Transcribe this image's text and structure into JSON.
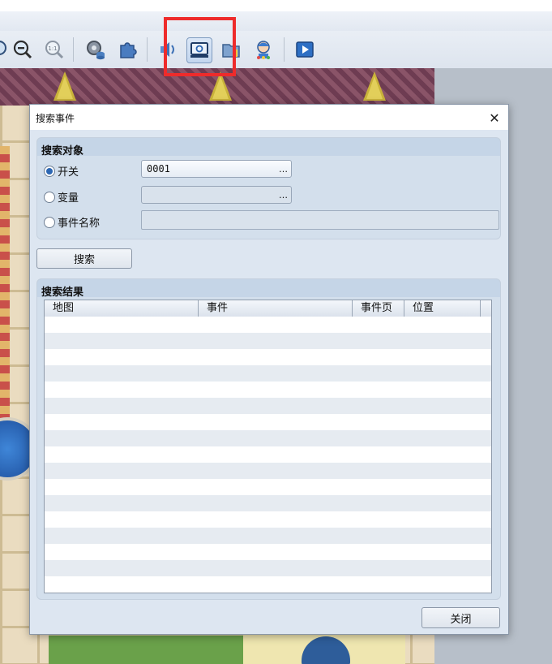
{
  "dialog": {
    "title": "搜索事件",
    "close_symbol": "✕"
  },
  "search_target": {
    "heading": "搜索对象",
    "options": [
      {
        "label": "开关",
        "selected": true,
        "value": "0001",
        "button": "…"
      },
      {
        "label": "变量",
        "selected": false,
        "value": "",
        "button": "…"
      },
      {
        "label": "事件名称",
        "selected": false,
        "value": ""
      }
    ]
  },
  "search_button": "搜索",
  "results": {
    "heading": "搜索结果",
    "columns": [
      "地图",
      "事件",
      "事件页",
      "位置"
    ],
    "rows": []
  },
  "close_button": "关闭",
  "toolbar": {
    "icons": [
      "zoom-out-icon",
      "zoom-actual-icon",
      "database-icon",
      "plugin-icon",
      "sound-test-icon",
      "event-search-icon",
      "resource-manager-icon",
      "character-generator-icon",
      "playtest-icon"
    ],
    "active": "event-search-icon",
    "zoom_actual_text": "1:1"
  }
}
